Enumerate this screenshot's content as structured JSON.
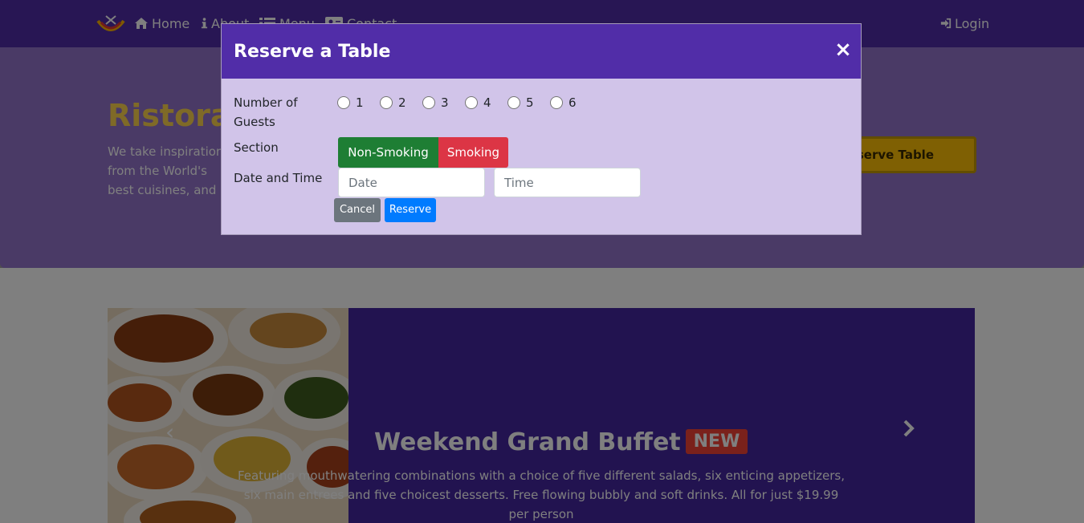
{
  "navbar": {
    "items": [
      {
        "label": "Home",
        "icon": "home-icon"
      },
      {
        "label": "About",
        "icon": "info-icon"
      },
      {
        "label": "Menu",
        "icon": "list-icon"
      },
      {
        "label": "Contact",
        "icon": "address-card-icon"
      }
    ],
    "login_label": "Login"
  },
  "jumbotron": {
    "title": "Ristorante con Fusion",
    "text": "We take inspiration from the World's best cuisines, and create a unique fusion experience. Our lipsmacking creations will tickle your culinary senses!",
    "button_label": "Reserve Table"
  },
  "carousel": {
    "title": "Weekend Grand Buffet",
    "badge": "NEW",
    "caption": "Featuring mouthwatering combinations with a choice of five different salads, six enticing appetizers, six main entrees and five choicest desserts. Free flowing bubbly and soft drinks. All for just $19.99 per person"
  },
  "modal": {
    "title": "Reserve a Table",
    "close_symbol": "×",
    "guests_label": "Number of Guests",
    "guest_options": [
      "1",
      "2",
      "3",
      "4",
      "5",
      "6"
    ],
    "section_label": "Section",
    "section_options": [
      "Non-Smoking",
      "Smoking"
    ],
    "datetime_label": "Date and Time",
    "date_placeholder": "Date",
    "time_placeholder": "Time",
    "cancel_label": "Cancel",
    "reserve_label": "Reserve"
  },
  "colors": {
    "navbar": "#512da8",
    "jumbotron": "#9575cd",
    "modal_header": "#512da8",
    "modal_body": "#d1c4e9",
    "non_smoking": "#1e7e34",
    "smoking": "#dc3545",
    "cancel": "#6c757d",
    "reserve": "#007bff",
    "accent_gold": "#ffc107"
  }
}
